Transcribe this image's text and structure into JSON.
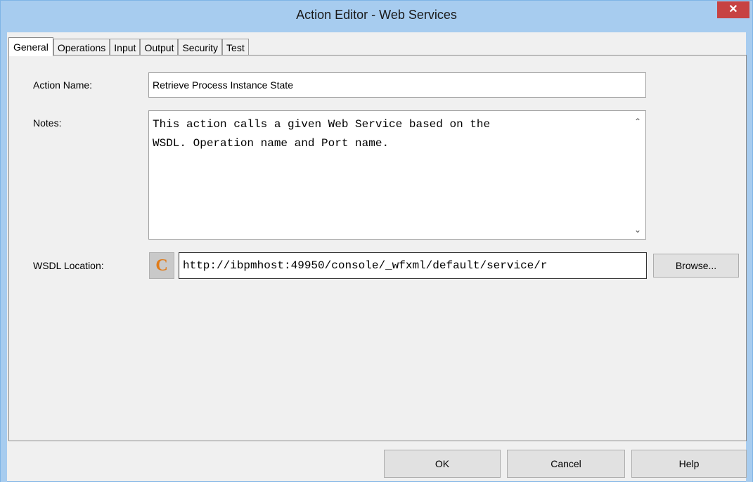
{
  "window": {
    "title": "Action Editor - Web Services",
    "close_glyph": "✕"
  },
  "tabs": [
    {
      "label": "General",
      "active": true
    },
    {
      "label": "Operations",
      "active": false
    },
    {
      "label": "Input",
      "active": false
    },
    {
      "label": "Output",
      "active": false
    },
    {
      "label": "Security",
      "active": false
    },
    {
      "label": "Test",
      "active": false
    }
  ],
  "form": {
    "action_name_label": "Action Name:",
    "action_name_value": "Retrieve Process Instance State",
    "notes_label": "Notes:",
    "notes_line1": "This action calls a given Web Service based on the",
    "notes_line2": "WSDL. Operation name and Port name.",
    "wsdl_label": "WSDL Location:",
    "wsdl_icon_letter": "C",
    "wsdl_value": "http://ibpmhost:49950/console/_wfxml/default/service/r",
    "browse_label": "Browse..."
  },
  "buttons": {
    "ok": "OK",
    "cancel": "Cancel",
    "help": "Help"
  },
  "colors": {
    "titlebar": "#a7ccef",
    "close": "#c74242",
    "icon_letter": "#e07b18"
  }
}
